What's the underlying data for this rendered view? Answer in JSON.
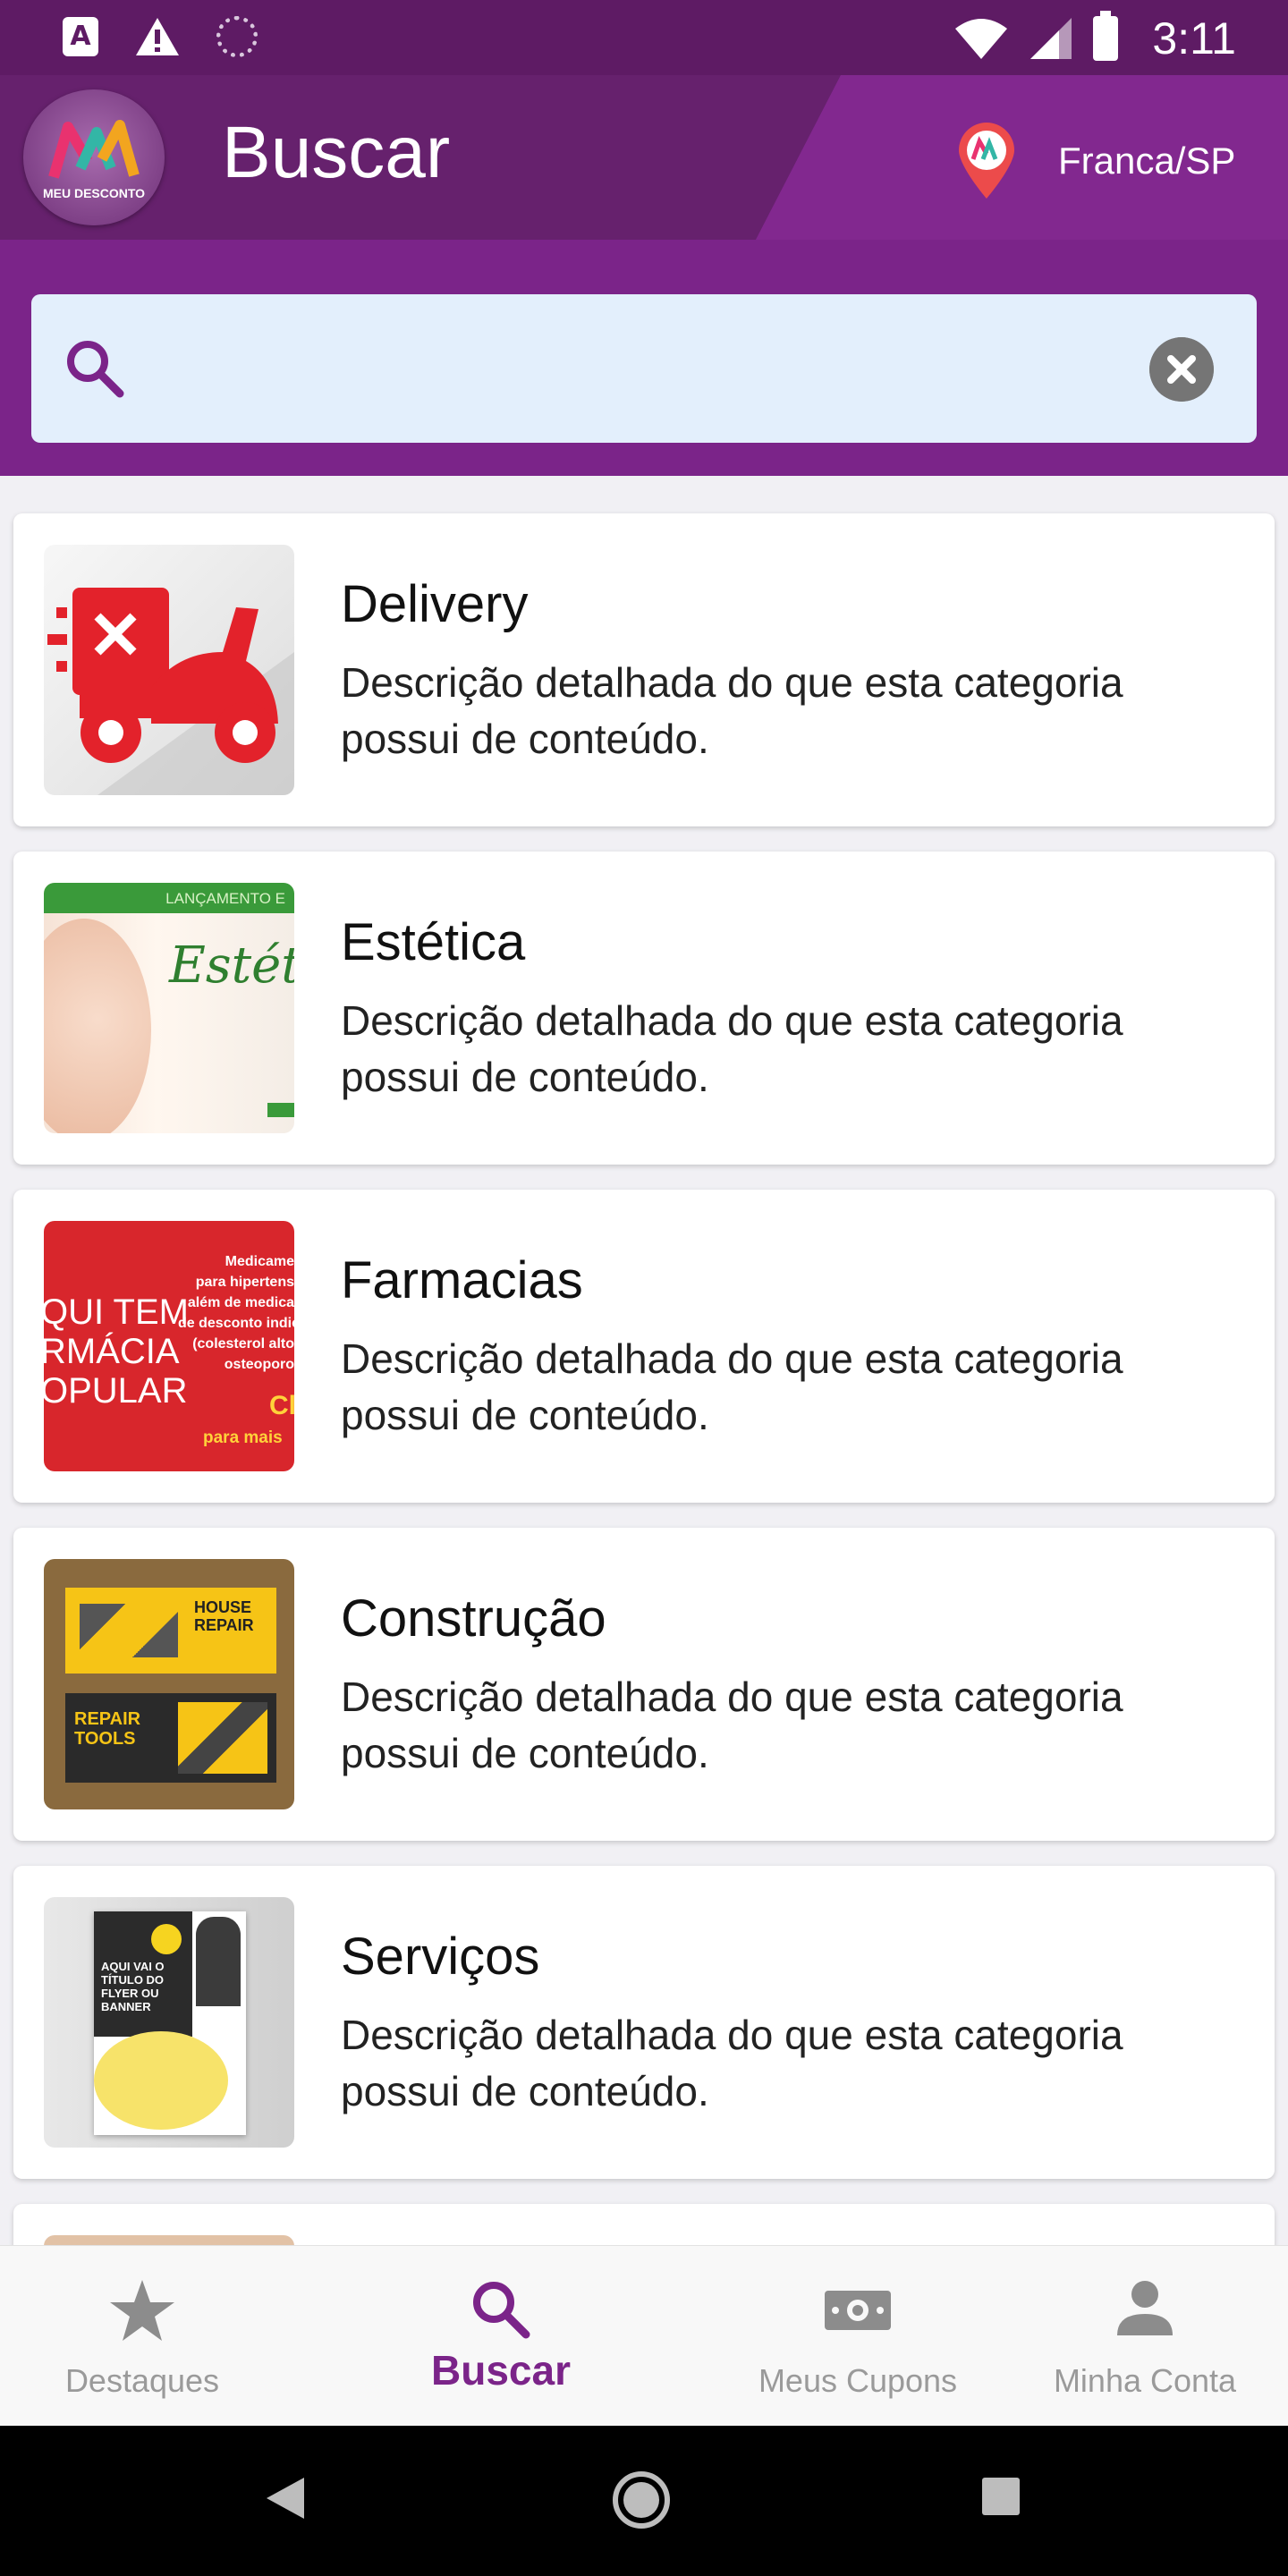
{
  "status_bar": {
    "time": "3:11",
    "a_badge": "A"
  },
  "header": {
    "logo_text": "MEU DESCONTO",
    "title": "Buscar",
    "city": "Franca/SP"
  },
  "search": {
    "value": "",
    "placeholder": ""
  },
  "categories": [
    {
      "title": "Delivery",
      "description": "Descrição detalhada do que esta categoria possui de conteúdo."
    },
    {
      "title": "Estética",
      "description": "Descrição detalhada do que esta categoria possui de conteúdo."
    },
    {
      "title": "Farmacias",
      "description": "Descrição detalhada do que esta categoria possui de conteúdo."
    },
    {
      "title": "Construção",
      "description": "Descrição detalhada do que esta categoria possui de conteúdo."
    },
    {
      "title": "Serviços",
      "description": "Descrição detalhada do que esta categoria possui de conteúdo."
    }
  ],
  "thumbnails": {
    "estetica_banner": "LANÇAMENTO E",
    "estetica_script": "Estéti",
    "farm_left": "QUI TEM\nRMÁCIA\nOPULAR",
    "farm_right": "Medicame\npara hipertens\nalém de medica\nde desconto indic\n(colesterol alto\nosteoporo",
    "farm_cl": "Cl",
    "farm_bottom": "para mais",
    "constr_top": "HOUSE REPAIR",
    "constr_bottom": "REPAIR TOOLS",
    "serv_title": "AQUI VAI O TÍTULO DO FLYER OU BANNER"
  },
  "bottom_nav": [
    {
      "label": "Destaques",
      "icon": "star-icon"
    },
    {
      "label": "Buscar",
      "icon": "search-icon"
    },
    {
      "label": "Meus Cupons",
      "icon": "money-icon"
    },
    {
      "label": "Minha Conta",
      "icon": "person-icon"
    }
  ],
  "colors": {
    "primary": "#7b2489",
    "primary_dark": "#5e1b64",
    "search_bg": "#e3effc",
    "delivery_red": "#e3222b"
  }
}
